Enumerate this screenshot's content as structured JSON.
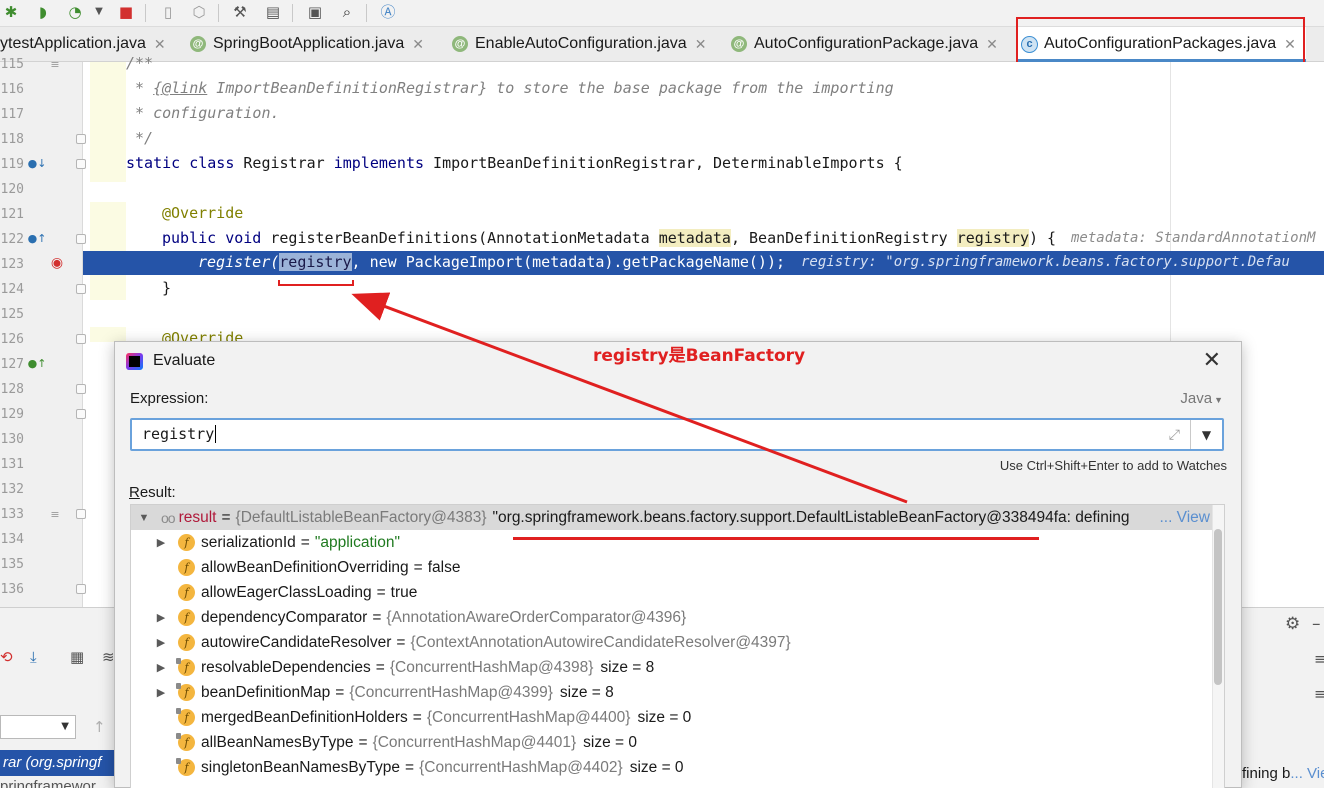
{
  "tabs": [
    {
      "label": "ytestApplication.java",
      "kind": "none"
    },
    {
      "label": "SpringBootApplication.java",
      "kind": "annotation"
    },
    {
      "label": "EnableAutoConfiguration.java",
      "kind": "annotation"
    },
    {
      "label": "AutoConfigurationPackage.java",
      "kind": "annotation"
    },
    {
      "label": "AutoConfigurationPackages.java",
      "kind": "class",
      "active": true
    }
  ],
  "tab_close": "✕",
  "editor": {
    "line_numbers": [
      "115",
      "116",
      "117",
      "118",
      "119",
      "120",
      "121",
      "122",
      "123",
      "124",
      "125",
      "126",
      "127",
      "128",
      "129",
      "130",
      "131",
      "132",
      "133",
      "134",
      "135",
      "136"
    ],
    "l115": "/**",
    "l116_star": " * ",
    "l116_link": "{@link",
    "l116_cls": " ImportBeanDefinitionRegistrar}",
    "l116_rest": " to store the base package from the importing",
    "l117": " * configuration.",
    "l118": " */",
    "l119_kw": "static class",
    "l119_name": " Registrar ",
    "l119_impl": "implements",
    "l119_rest": " ImportBeanDefinitionRegistrar, DeterminableImports {",
    "l121": "@Override",
    "l122_kw": "public void",
    "l122_name": " registerBeanDefinitions(AnnotationMetadata ",
    "l122_p1": "metadata",
    "l122_mid": ", BeanDefinitionRegistry ",
    "l122_p2": "registry",
    "l122_end": ") {",
    "l122_hint": "metadata: StandardAnnotationM",
    "l123_call": "register(",
    "l123_sel": "registry",
    "l123_rest": ", new PackageImport(metadata).getPackageName());",
    "l123_hint": "registry: \"org.springframework.beans.factory.support.Defau",
    "l124": "}",
    "l126": "@Override"
  },
  "annotation_note": "registry是BeanFactory",
  "dialog": {
    "title": "Evaluate",
    "expression_label": "Expression:",
    "language": "Java",
    "expression_value": "registry",
    "watch_hint": "Use Ctrl+Shift+Enter to add to Watches",
    "result_label_first": "R",
    "result_label_rest": "esult:",
    "result_row": {
      "name": "result",
      "type": "{DefaultListableBeanFactory@4383}",
      "value": "\"org.springframework.beans.factory.support.DefaultListableBeanFactory@338494fa: defining",
      "view": "... View"
    },
    "fields": [
      {
        "name": "serializationId",
        "value": "\"application\"",
        "kind": "str",
        "expandable": true,
        "lock": false
      },
      {
        "name": "allowBeanDefinitionOverriding",
        "value": "false",
        "kind": "plain",
        "expandable": false,
        "lock": false
      },
      {
        "name": "allowEagerClassLoading",
        "value": "true",
        "kind": "plain",
        "expandable": false,
        "lock": false
      },
      {
        "name": "dependencyComparator",
        "value": "{AnnotationAwareOrderComparator@4396}",
        "kind": "ref",
        "expandable": true,
        "lock": false
      },
      {
        "name": "autowireCandidateResolver",
        "value": "{ContextAnnotationAutowireCandidateResolver@4397}",
        "kind": "ref",
        "expandable": true,
        "lock": false
      },
      {
        "name": "resolvableDependencies",
        "value": "{ConcurrentHashMap@4398}",
        "size": "size = 8",
        "kind": "ref",
        "expandable": true,
        "lock": true
      },
      {
        "name": "beanDefinitionMap",
        "value": "{ConcurrentHashMap@4399}",
        "size": "size = 8",
        "kind": "ref",
        "expandable": true,
        "lock": true
      },
      {
        "name": "mergedBeanDefinitionHolders",
        "value": "{ConcurrentHashMap@4400}",
        "size": "size = 0",
        "kind": "ref",
        "expandable": false,
        "lock": true
      },
      {
        "name": "allBeanNamesByType",
        "value": "{ConcurrentHashMap@4401}",
        "size": "size = 0",
        "kind": "ref",
        "expandable": false,
        "lock": true
      },
      {
        "name": "singletonBeanNamesByType",
        "value": "{ConcurrentHashMap@4402}",
        "size": "size = 0",
        "kind": "ref",
        "expandable": false,
        "lock": true
      }
    ]
  },
  "frames": {
    "selected": "rar (org.springf",
    "next": "pringframewor"
  },
  "right_fragment": "fining b",
  "right_view": "... Vie",
  "colors": {
    "accent": "#2554a8",
    "annotation_red": "#e02020",
    "field_icon": "#f4b63f"
  }
}
